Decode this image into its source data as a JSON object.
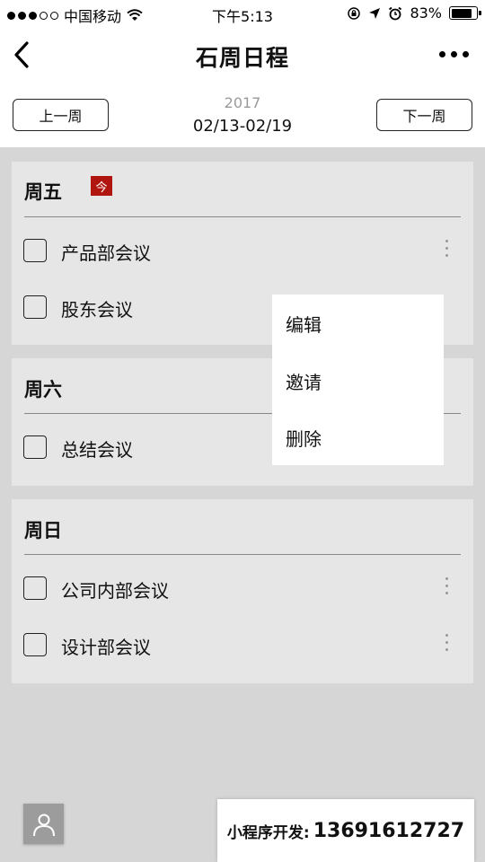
{
  "status_bar": {
    "carrier": "中国移动",
    "time": "下午5:13",
    "battery": "83%",
    "battery_level": 0.83,
    "icons": [
      "signal-dots",
      "wifi-icon",
      "orientation-lock-icon",
      "location-arrow-icon",
      "alarm-icon",
      "battery-icon"
    ]
  },
  "nav": {
    "title": "石周日程",
    "back_icon": "chevron-left-icon",
    "more_icon": "more-horizontal-icon"
  },
  "week_nav": {
    "prev_label": "上一周",
    "next_label": "下一周",
    "year": "2017",
    "range": "02/13-02/19"
  },
  "days": [
    {
      "title": "周五",
      "today_badge": "今",
      "tasks": [
        "产品部会议",
        "股东会议"
      ]
    },
    {
      "title": "周六",
      "tasks": [
        "总结会议"
      ]
    },
    {
      "title": "周日",
      "tasks": [
        "公司内部会议",
        "设计部会议"
      ]
    }
  ],
  "popup_menu": {
    "items": [
      "编辑",
      "邀请",
      "删除"
    ]
  },
  "bottom": {
    "avatar_icon": "user-icon",
    "promo_label": "小程序开发:",
    "promo_phone": "13691612727"
  },
  "colors": {
    "today_badge": "#b0160f",
    "card_background": "#e6e6e6",
    "page_background": "#d6d6d6"
  }
}
